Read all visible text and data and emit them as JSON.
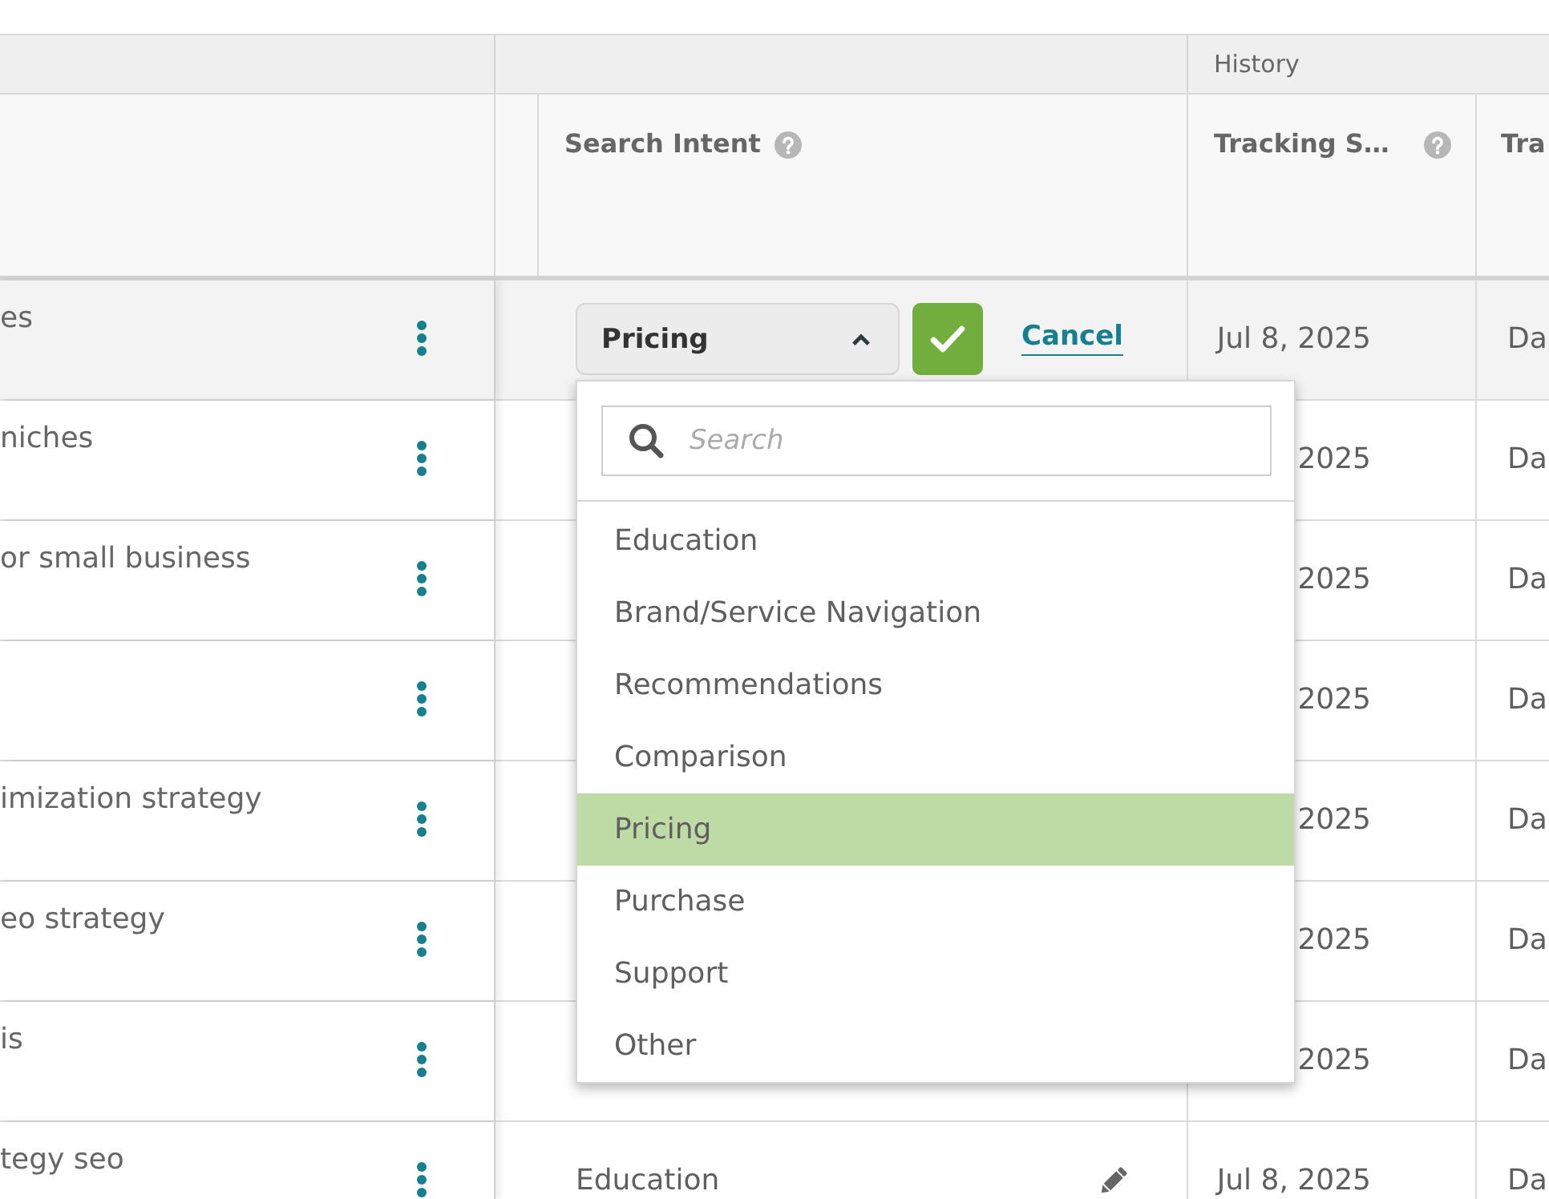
{
  "table": {
    "group_header": {
      "label": "History"
    },
    "columns": [
      {
        "label": "Search Intent",
        "help": true
      },
      {
        "label": "Tracking S…",
        "help": true
      },
      {
        "label": "Tra",
        "help": false
      }
    ],
    "rows": [
      {
        "highlighted": true,
        "keyword": "es",
        "search_intent": {
          "kind": "editor",
          "value": "Pricing",
          "expanded": true,
          "cancel": "Cancel",
          "menu": {
            "search": {
              "placeholder": "Search"
            },
            "options": [
              {
                "label": "Education",
                "selected": false
              },
              {
                "label": "Brand/Service Navigation",
                "selected": false
              },
              {
                "label": "Recommendations",
                "selected": false
              },
              {
                "label": "Comparison",
                "selected": false
              },
              {
                "label": "Pricing",
                "selected": true
              },
              {
                "label": "Purchase",
                "selected": false
              },
              {
                "label": "Support",
                "selected": false
              },
              {
                "label": "Other",
                "selected": false
              }
            ]
          }
        },
        "tracking_start": "Jul 8, 2025",
        "column_5": "Da"
      },
      {
        "highlighted": false,
        "keyword": "niches",
        "tracking_start": "2025",
        "column_5": "Da"
      },
      {
        "highlighted": false,
        "keyword": "or small business",
        "tracking_start": "2025",
        "column_5": "Da"
      },
      {
        "highlighted": false,
        "tracking_start": "2025",
        "column_5": "Da"
      },
      {
        "highlighted": false,
        "keyword": "imization strategy",
        "tracking_start": "2025",
        "column_5": "Da"
      },
      {
        "highlighted": false,
        "keyword": "eo strategy",
        "tracking_start": "2025",
        "column_5": "Da"
      },
      {
        "highlighted": false,
        "keyword": "is",
        "tracking_start": "2025",
        "column_5": "Da"
      },
      {
        "highlighted": false,
        "keyword": "tegy seo",
        "search_intent": {
          "kind": "text",
          "value": "Education"
        },
        "tracking_start": "Jul 8, 2025",
        "column_5": "Da"
      }
    ]
  }
}
